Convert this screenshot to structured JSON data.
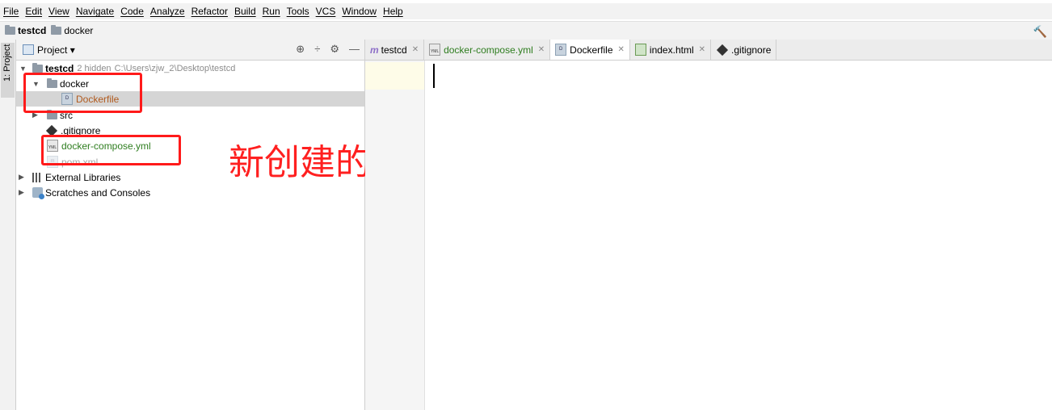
{
  "menu": [
    "File",
    "Edit",
    "View",
    "Navigate",
    "Code",
    "Analyze",
    "Refactor",
    "Build",
    "Run",
    "Tools",
    "VCS",
    "Window",
    "Help"
  ],
  "breadcrumb": {
    "project": "testcd",
    "folder": "docker"
  },
  "sidebar_strip": {
    "label": "1: Project"
  },
  "project_panel": {
    "title": "Project",
    "root": {
      "name": "testcd",
      "hidden": "2 hidden",
      "path": "C:\\Users\\zjw_2\\Desktop\\testcd"
    },
    "items": {
      "docker": "docker",
      "dockerfile": "Dockerfile",
      "src": "src",
      "gitignore": ".gitignore",
      "compose": "docker-compose.yml",
      "pom": "pom.xml",
      "ext_libs": "External Libraries",
      "scratches": "Scratches and Consoles"
    }
  },
  "annotation": "新创建的两个文件",
  "tabs": [
    {
      "label": "testcd"
    },
    {
      "label": "docker-compose.yml"
    },
    {
      "label": "Dockerfile"
    },
    {
      "label": "index.html"
    },
    {
      "label": ".gitignore"
    }
  ],
  "colors": {
    "accent_red": "#ff1a1a",
    "vcs_green": "#2e7d1f",
    "modified_orange": "#b05a1e"
  }
}
